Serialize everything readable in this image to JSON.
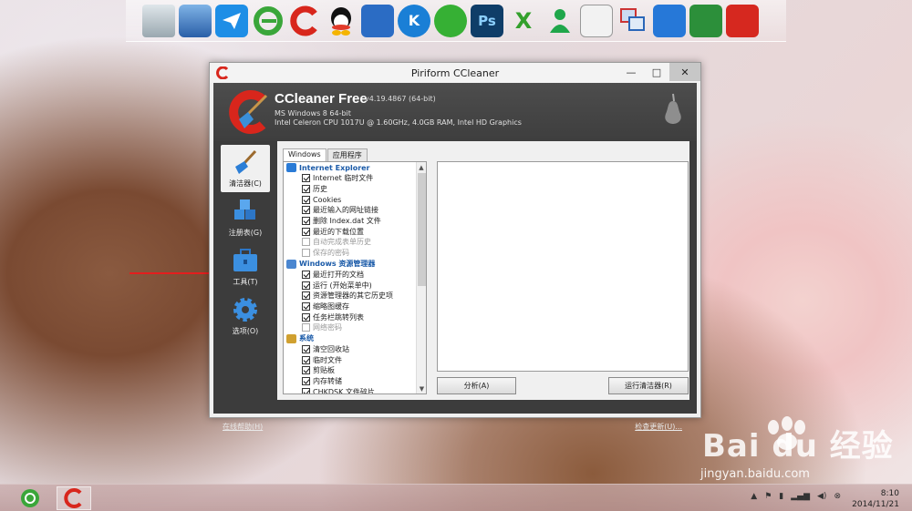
{
  "dock": {
    "icons": [
      "recycle-bin-icon",
      "computer-icon",
      "feige-icon",
      "ie-icon",
      "ccleaner-icon",
      "qq-icon",
      "video-icon",
      "kugou-icon",
      "aiqiyi-icon",
      "photoshop-icon",
      "excel-icon",
      "user-icon",
      "backup-icon",
      "network-icon",
      "window-icon",
      "image-icon",
      "media-icon"
    ],
    "ps_label": "Ps",
    "k_label": "K",
    "x_label": "X"
  },
  "window": {
    "title": "Piriform CCleaner",
    "app_name": "CCleaner Free",
    "app_version": "v4.19.4867 (64-bit)",
    "sysinfo_line1": "MS Windows 8 64-bit",
    "sysinfo_line2": "Intel Celeron CPU 1017U @ 1.60GHz, 4.0GB RAM, Intel HD Graphics",
    "controls": {
      "minimize": "—",
      "maximize": "□",
      "close": "✕"
    }
  },
  "nav": [
    {
      "label": "清洁器(C)",
      "active": true
    },
    {
      "label": "注册表(G)",
      "active": false
    },
    {
      "label": "工具(T)",
      "active": false
    },
    {
      "label": "选项(O)",
      "active": false
    }
  ],
  "tabs": [
    "Windows",
    "应用程序"
  ],
  "tree": {
    "groups": [
      {
        "name": "Internet Explorer",
        "items": [
          {
            "label": "Internet 临时文件",
            "checked": true
          },
          {
            "label": "历史",
            "checked": true
          },
          {
            "label": "Cookies",
            "checked": true
          },
          {
            "label": "最近输入的网址链接",
            "checked": true
          },
          {
            "label": "删除 Index.dat 文件",
            "checked": true
          },
          {
            "label": "最近的下载位置",
            "checked": true
          },
          {
            "label": "自动完成表单历史",
            "checked": false
          },
          {
            "label": "保存的密码",
            "checked": false
          }
        ]
      },
      {
        "name": "Windows 资源管理器",
        "items": [
          {
            "label": "最近打开的文档",
            "checked": true
          },
          {
            "label": "运行 (开始菜单中)",
            "checked": true
          },
          {
            "label": "资源管理器的其它历史项",
            "checked": true
          },
          {
            "label": "缩略图缓存",
            "checked": true
          },
          {
            "label": "任务栏跳转列表",
            "checked": true
          },
          {
            "label": "网络密码",
            "checked": false
          }
        ]
      },
      {
        "name": "系统",
        "items": [
          {
            "label": "清空回收站",
            "checked": true
          },
          {
            "label": "临时文件",
            "checked": true
          },
          {
            "label": "剪贴板",
            "checked": true
          },
          {
            "label": "内存转储",
            "checked": true
          },
          {
            "label": "CHKDSK 文件碎片",
            "checked": true
          }
        ]
      }
    ]
  },
  "buttons": {
    "analyze": "分析(A)",
    "run": "运行清洁器(R)"
  },
  "footer": {
    "help": "在线帮助(H)",
    "update": "检查更新(U)..."
  },
  "watermark": {
    "text": "Bai du 经验",
    "sub": "jingyan.baidu.com"
  },
  "taskbar": {
    "time": "8:10",
    "date": "2014/11/21"
  }
}
